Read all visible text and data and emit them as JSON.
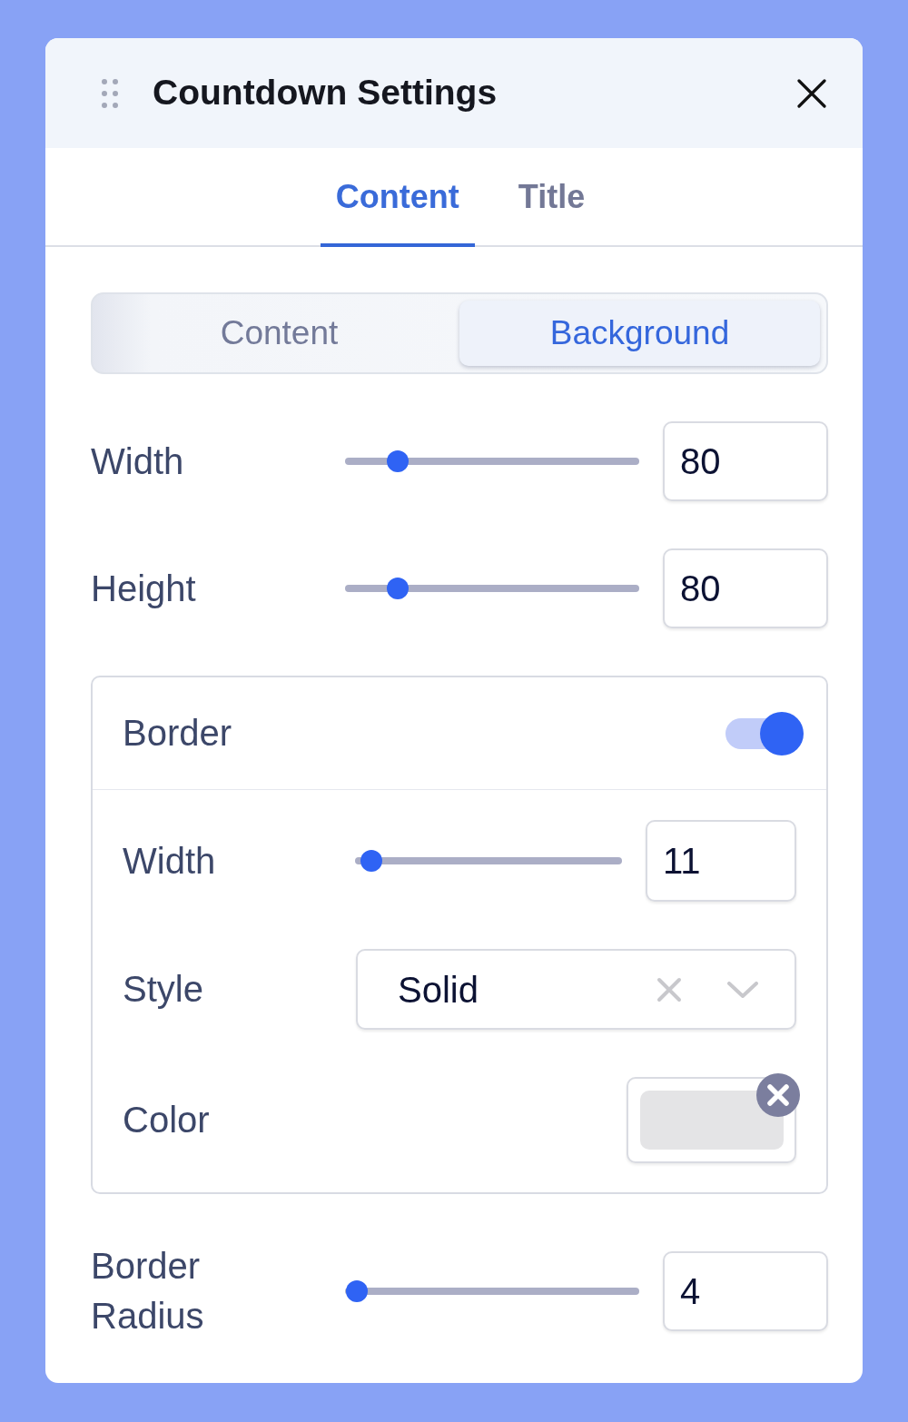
{
  "window": {
    "title": "Countdown Settings"
  },
  "tabs": [
    {
      "label": "Content",
      "selected": true
    },
    {
      "label": "Title",
      "selected": false
    }
  ],
  "segments": [
    {
      "label": "Content",
      "selected": false
    },
    {
      "label": "Background",
      "selected": true
    }
  ],
  "controls": [
    {
      "kind": "slider",
      "label": "Width",
      "level": 0.18,
      "value": "80"
    },
    {
      "kind": "slider",
      "label": "Height",
      "level": 0.18,
      "value": "80"
    },
    {
      "kind": "group",
      "label": "Border",
      "on": true,
      "items": [
        {
          "kind": "slider",
          "label": "Width",
          "level": 0.06,
          "value": "11"
        },
        {
          "kind": "select",
          "label": "Style",
          "value": "Solid"
        },
        {
          "kind": "color",
          "label": "Color",
          "color": "#e4e4e6"
        }
      ]
    },
    {
      "kind": "slider",
      "label": "Border Radius",
      "level": 0.04,
      "value": "4"
    }
  ]
}
